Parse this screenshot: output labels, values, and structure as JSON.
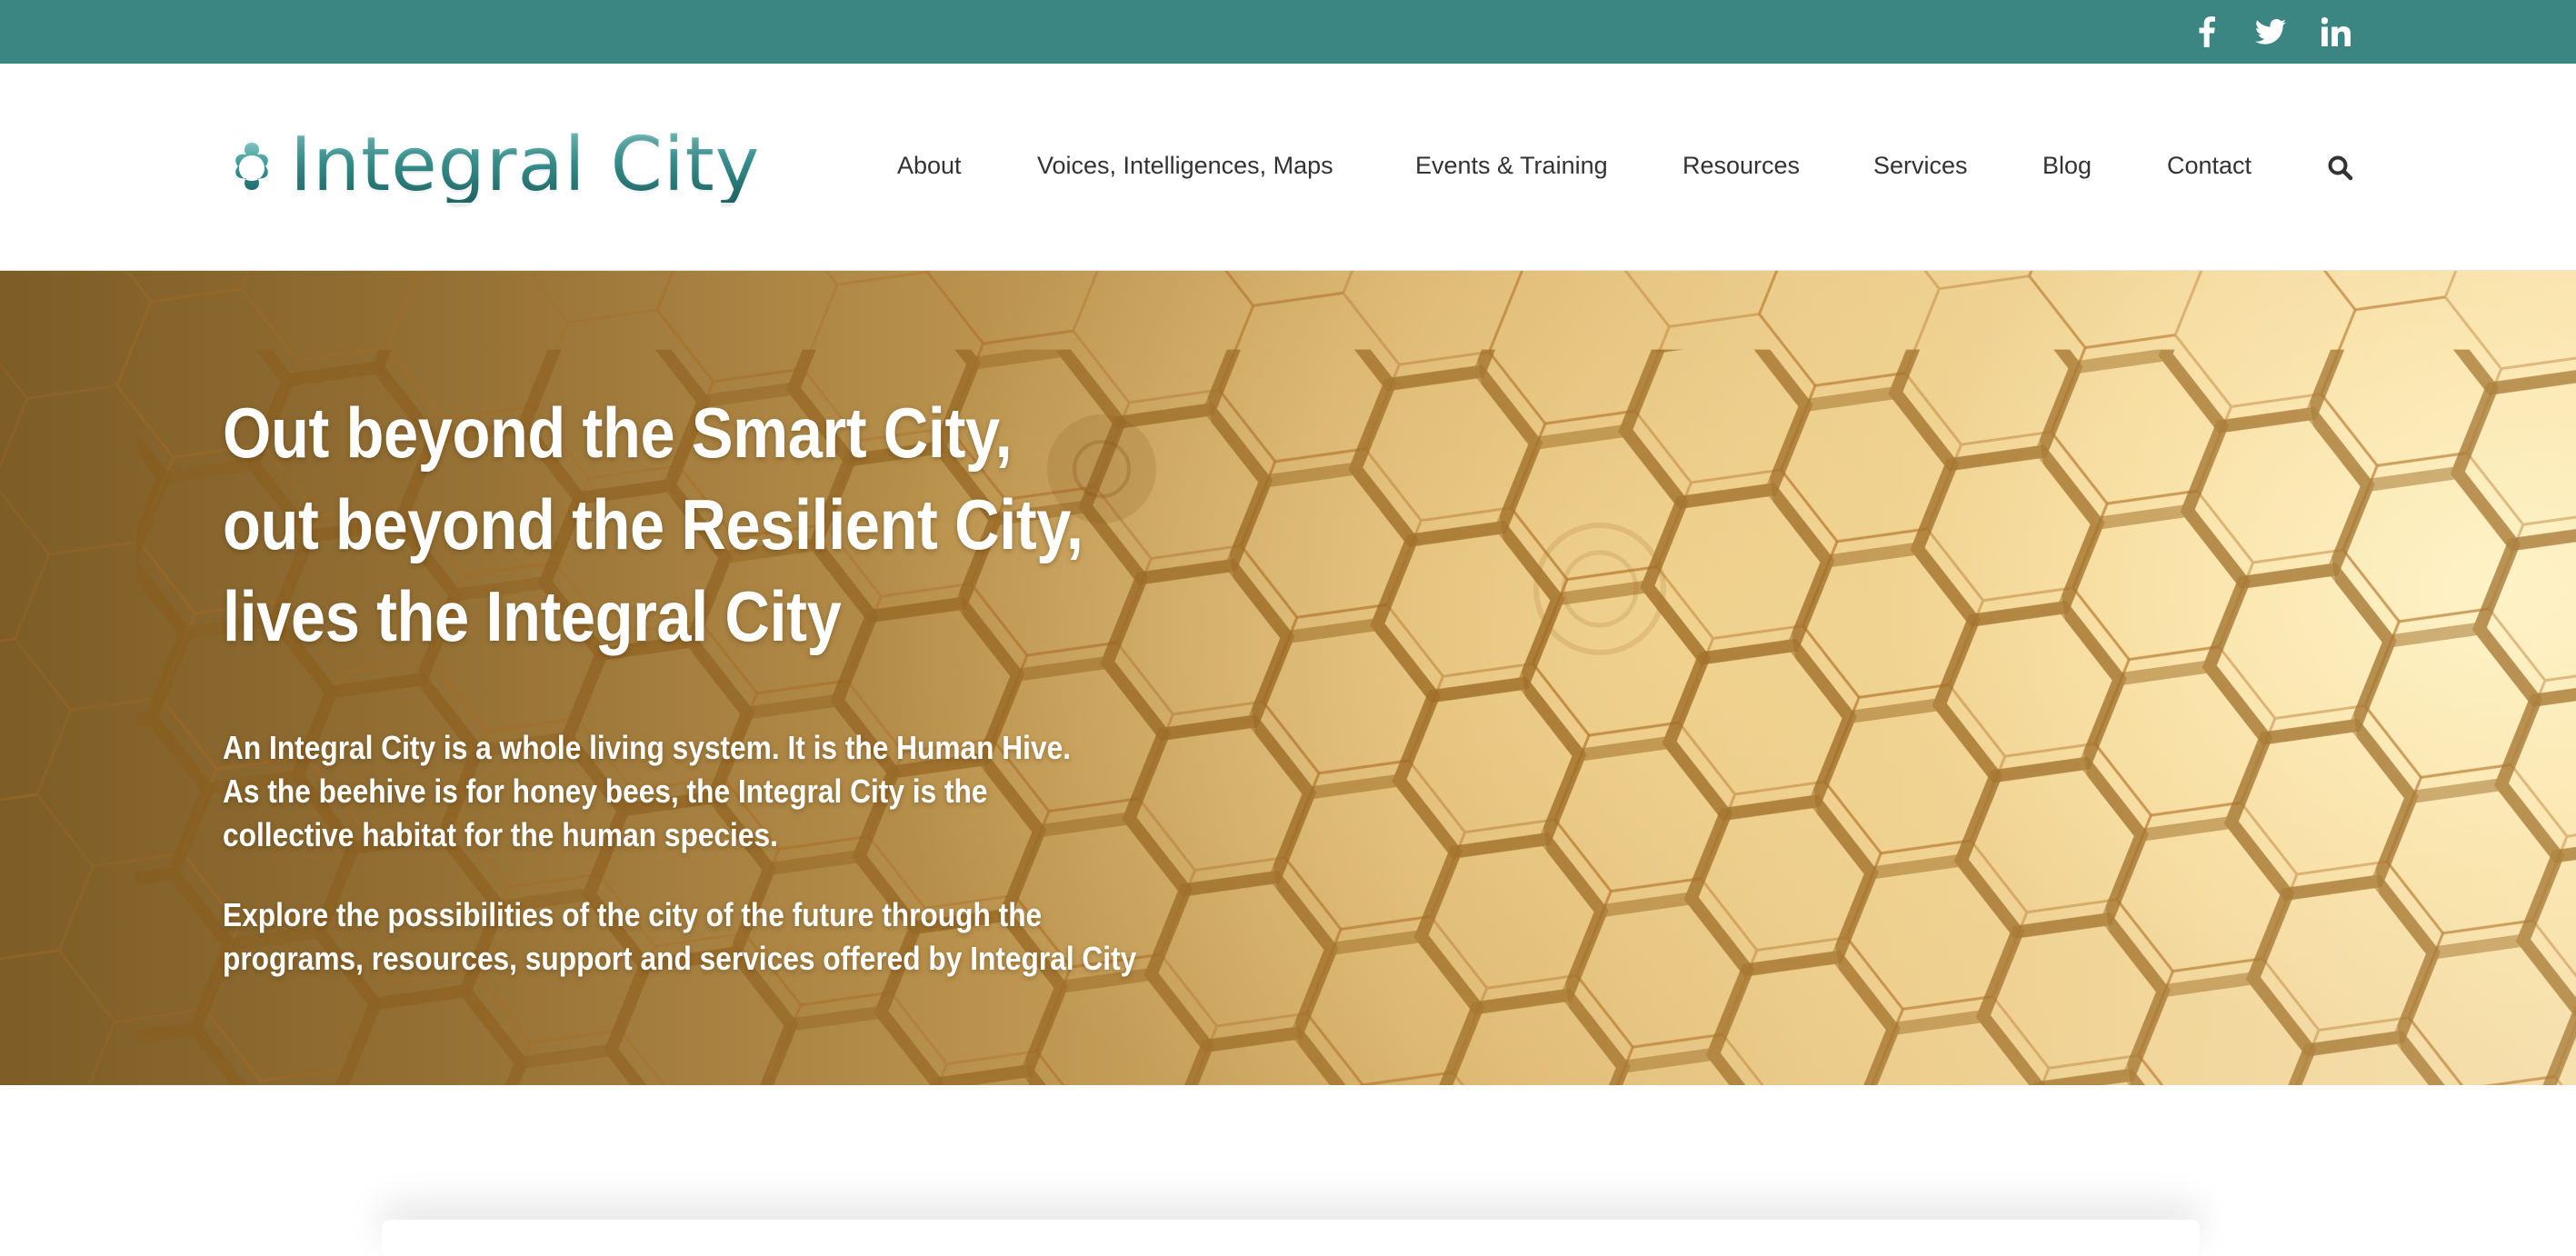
{
  "social": {
    "facebook_icon": "facebook-icon",
    "twitter_icon": "twitter-icon",
    "linkedin_icon": "linkedin-icon"
  },
  "header": {
    "logo_text": "Integral City",
    "nav": [
      {
        "label": "About"
      },
      {
        "label": "Voices, Intelligences, Maps"
      },
      {
        "label": "Events & Training"
      },
      {
        "label": "Resources"
      },
      {
        "label": "Services"
      },
      {
        "label": "Blog"
      },
      {
        "label": "Contact"
      }
    ],
    "search_icon": "search-icon"
  },
  "hero": {
    "title_lines": [
      "Out beyond the Smart City,",
      "out beyond the Resilient City,",
      "lives the Integral City"
    ],
    "paragraph1_lines": [
      "An Integral City is a whole living system. It is the Human Hive.",
      "As the beehive is for honey bees, the Integral City is the",
      "collective habitat for the human species."
    ],
    "paragraph2_lines": [
      "Explore the possibilities of the city of the future through the",
      "programs, resources, support and services offered by Integral City"
    ]
  },
  "colors": {
    "topbar": "#3b8583",
    "brand_teal": "#3b9795",
    "nav_text": "#333333",
    "hero_text": "#ffffff"
  }
}
